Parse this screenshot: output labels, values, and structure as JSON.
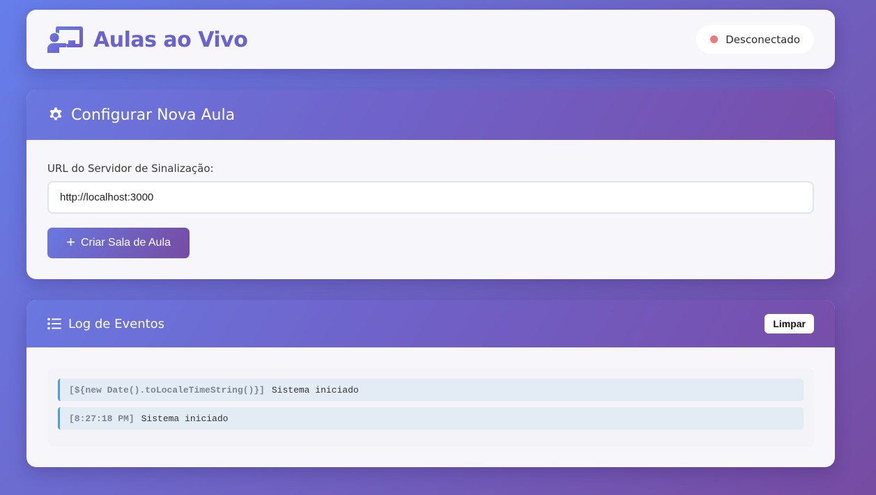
{
  "header": {
    "title": "Aulas ao Vivo",
    "icon": "chalkboard-teacher-icon",
    "status": {
      "label": "Desconectado",
      "dot_color": "#ec7a7a"
    }
  },
  "config": {
    "title": "Configurar Nova Aula",
    "icon": "gear-icon",
    "url_label": "URL do Servidor de Sinalização:",
    "url_value": "http://localhost:3000",
    "create_button": "Criar Sala de Aula"
  },
  "log": {
    "title": "Log de Eventos",
    "icon": "list-icon",
    "clear_button": "Limpar",
    "entries": [
      {
        "time": "[${new Date().toLocaleTimeString()}]",
        "message": "Sistema iniciado"
      },
      {
        "time": "[8:27:18 PM]",
        "message": "Sistema iniciado"
      }
    ]
  },
  "colors": {
    "gradient_start": "#667eea",
    "gradient_end": "#764ba2",
    "title_color": "#6a63cf"
  }
}
